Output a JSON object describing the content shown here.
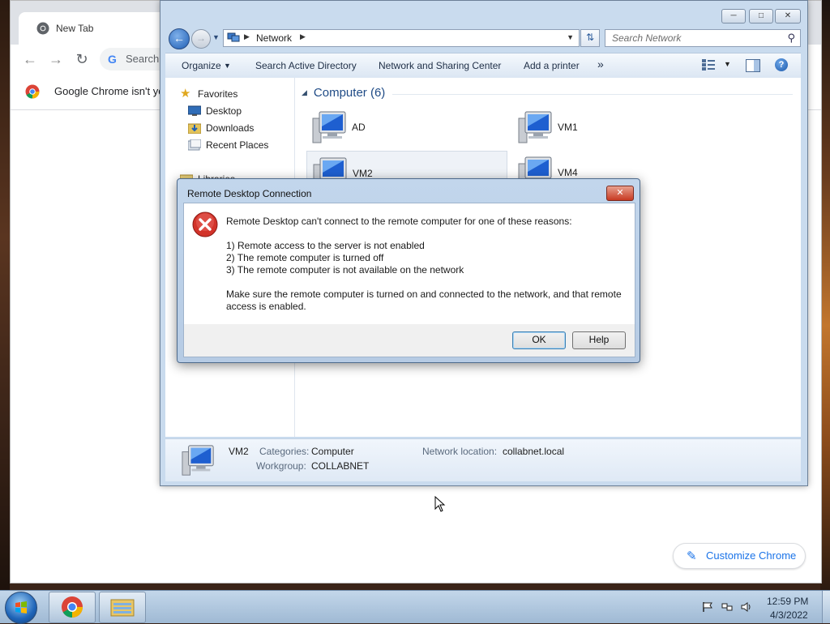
{
  "chrome": {
    "tab_title": "New Tab",
    "omnibox_text": "Search",
    "infobar_text": "Google Chrome isn't yo",
    "customize_label": "Customize Chrome"
  },
  "explorer": {
    "address": "Network",
    "search_placeholder": "Search Network",
    "commands": [
      "Organize",
      "Search Active Directory",
      "Network and Sharing Center",
      "Add a printer"
    ],
    "nav": {
      "favorites": "Favorites",
      "desktop": "Desktop",
      "downloads": "Downloads",
      "recent": "Recent Places",
      "libraries": "Libraries"
    },
    "group_label": "Computer (6)",
    "computers": [
      "AD",
      "VM1",
      "VM2",
      "VM4"
    ],
    "details": {
      "name": "VM2",
      "categories_label": "Categories:",
      "categories_value": "Computer",
      "workgroup_label": "Workgroup:",
      "workgroup_value": "COLLABNET",
      "network_label": "Network location:",
      "network_value": "collabnet.local"
    }
  },
  "dialog": {
    "title": "Remote Desktop Connection",
    "message": "Remote Desktop can't connect to the remote computer for one of these reasons:",
    "reason1": "1) Remote access to the server is not enabled",
    "reason2": "2) The remote computer is turned off",
    "reason3": "3) The remote computer is not available on the network",
    "advice_line1": "Make sure the remote computer is turned on and connected to the network, and that remote",
    "advice_line2": "access is enabled.",
    "ok_label": "OK",
    "help_label": "Help"
  },
  "taskbar": {
    "time": "12:59 PM",
    "date": "4/3/2022"
  },
  "colors": {
    "explorer_frame": "#c9dbee",
    "dialog_frame": "#b6cbe4",
    "chrome_link": "#1a73e8",
    "group_header": "#1f4b86"
  }
}
